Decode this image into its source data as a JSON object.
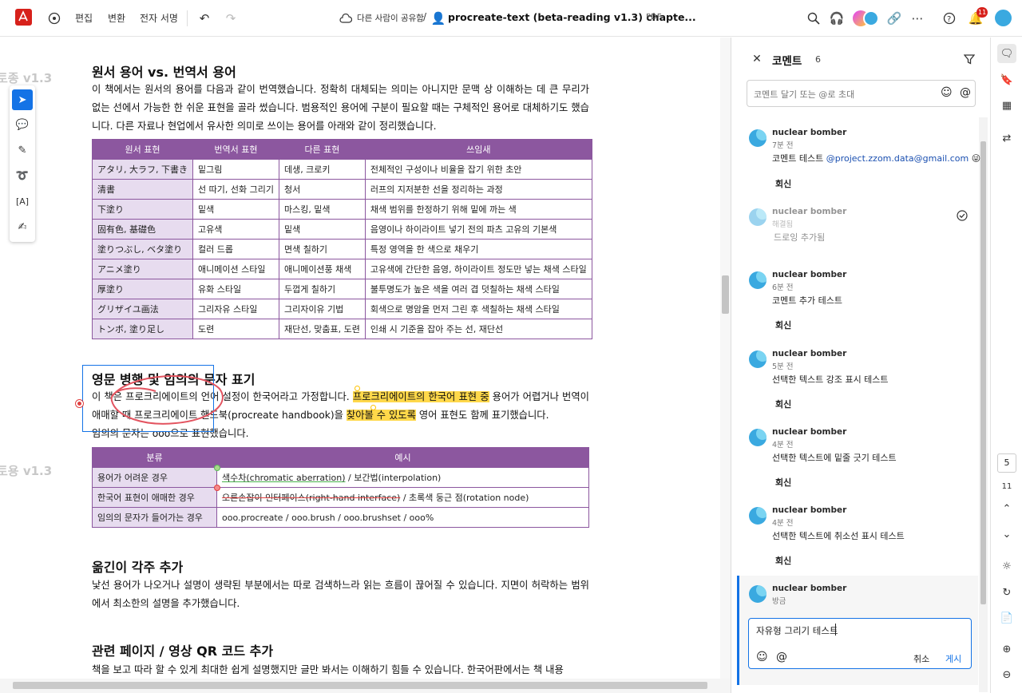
{
  "topbar": {
    "menu": [
      "편집",
      "변환",
      "전자 서명"
    ],
    "share_text": "다른 사람이 공유함",
    "doc_title": "procreate-text (beta-reading v1.3) chapte...",
    "doc_type": "PDF",
    "notification_count": "11"
  },
  "watermark": {
    "w1": "토종 v1.3",
    "w2": "토용 v1.3"
  },
  "doc": {
    "s1_title": "원서 용어 vs. 번역서 용어",
    "s1_para": "이 책에서는 원서의 용어를 다음과 같이 번역했습니다. 정확히 대체되는 의미는 아니지만 문맥 상 이해하는 데 큰 무리가 없는 선에서 가능한 한 쉬운 표현을 골라 썼습니다. 범용적인 용어에 구분이 필요할 때는 구체적인 용어로 대체하기도 했습니다. 다른 자료나 현업에서 유사한 의미로 쓰이는 용어를 아래와 같이 정리했습니다.",
    "t1_headers": [
      "원서 표현",
      "번역서 표현",
      "다른 표현",
      "쓰임새"
    ],
    "t1_rows": [
      [
        "アタリ, 大ラフ, 下書き",
        "밑그림",
        "데생, 크로키",
        "전체적인 구성이나 비율을 잡기 위한 초안"
      ],
      [
        "清書",
        "선 따기, 선화 그리기",
        "청서",
        "러프의 지저분한 선을 정리하는 과정"
      ],
      [
        "下塗り",
        "밑색",
        "마스킹, 밑색",
        "채색 범위를 한정하기 위해 밑에 까는 색"
      ],
      [
        "固有色, 基礎色",
        "고유색",
        "밑색",
        "음영이나 하이라이트 넣기 전의 파츠 고유의 기본색"
      ],
      [
        "塗りつぶし, ベタ塗り",
        "컬러 드롭",
        "면색 칠하기",
        "특정 영역을 한 색으로 채우기"
      ],
      [
        "アニメ塗り",
        "애니메이션 스타일",
        "애니메이션풍 채색",
        "고유색에 간단한 음영, 하이라이트 정도만 넣는 채색 스타일"
      ],
      [
        "厚塗り",
        "유화 스타일",
        "두껍게 칠하기",
        "불투명도가 높은 색을 여러 겹 덧칠하는 채색 스타일"
      ],
      [
        "グリザイユ画法",
        "그리자유 스타일",
        "그리자이유 기법",
        "회색으로 명암을 먼저 그린 후 색칠하는 채색 스타일"
      ],
      [
        "トンボ, 塗り足し",
        "도련",
        "재단선, 맞춤표, 도련",
        "인쇄 시 기준을 잡아 주는 선, 재단선"
      ]
    ],
    "s2_title": "영문 병행 및 임의의 문자 표기",
    "s2_p1a": "이 책은 프로크리에이트의 언어 설정이 한국어라고 가정합니다. ",
    "s2_p1_hl1": "프로크리에이트의 한국어 표현 중",
    "s2_p1b": " 용어가 어렵거나 번역이 애매할 때 프로크리에이트 핸드북(procreate handbook)을 ",
    "s2_p1_hl2": "찾아볼 수 있도록",
    "s2_p1c": " 영어 표현도 함께 표기했습니다.",
    "s2_p2": "임의의 문자는 ooo으로 표현했습니다.",
    "t2_headers": [
      "분류",
      "예시"
    ],
    "t2_r1_c1": "용어가 어려운 경우",
    "t2_r1_ul": "색수차(chromatic aberration)",
    "t2_r1_rest": " / 보간법(interpolation)",
    "t2_r2_c1": "한국어 표현이 애매한 경우",
    "t2_r2_st": "오른손잡이 인터페이스(right-hand interface)",
    "t2_r2_rest": " / 초록색 둥근 점(rotation node)",
    "t2_r3_c1": "임의의 문자가 들어가는 경우",
    "t2_r3_c2": "ooo.procreate / ooo.brush / ooo.brushset / ooo%",
    "s3_title": "옮긴이 각주 추가",
    "s3_para": "낯선 용어가 나오거나 설명이 생략된 부분에서는 따로 검색하느라 읽는 흐름이 끊어질 수 있습니다. 지면이 허락하는 범위에서 최소한의 설명을 추가했습니다.",
    "s4_title": "관련 페이지 / 영상 QR 코드 추가",
    "s4_para": "책을 보고 따라 할 수 있게 최대한 쉽게 설명했지만 글만 봐서는 이해하기 힘들 수 있습니다. 한국어판에서는 책 내용"
  },
  "comments_panel": {
    "title": "코멘트",
    "count": "6",
    "input_placeholder": "코멘트 달기 또는 @로 초대",
    "reply_label": "회신",
    "items": [
      {
        "name": "nuclear bomber",
        "time": "7분 전",
        "text": "코멘트 테스트 ",
        "mention": "@project.zzom.data@gmail.com",
        "emoji": "😜"
      },
      {
        "name": "nuclear bomber",
        "time": "해결됨",
        "text": "드로잉 추가됨"
      },
      {
        "name": "nuclear bomber",
        "time": "6분 전",
        "text": "코멘트 추가 테스트"
      },
      {
        "name": "nuclear bomber",
        "time": "5분 전",
        "text": "선택한 텍스트 강조 표시 테스트"
      },
      {
        "name": "nuclear bomber",
        "time": "4분 전",
        "text": "선택한 텍스트에 밑줄 긋기 테스트"
      },
      {
        "name": "nuclear bomber",
        "time": "4분 전",
        "text": "선택한 텍스트에 취소선 표시 테스트"
      },
      {
        "name": "nuclear bomber",
        "time": "방금"
      }
    ],
    "draft_text": "자유형 그리기 테스트",
    "cancel_label": "취소",
    "post_label": "게시"
  },
  "rail": {
    "page_current": "5",
    "page_total": "11"
  },
  "colors": {
    "accent": "#1473e6",
    "table_header": "#8c579f",
    "table_first_col": "#e7dcef",
    "highlight": "#ffd84a"
  }
}
